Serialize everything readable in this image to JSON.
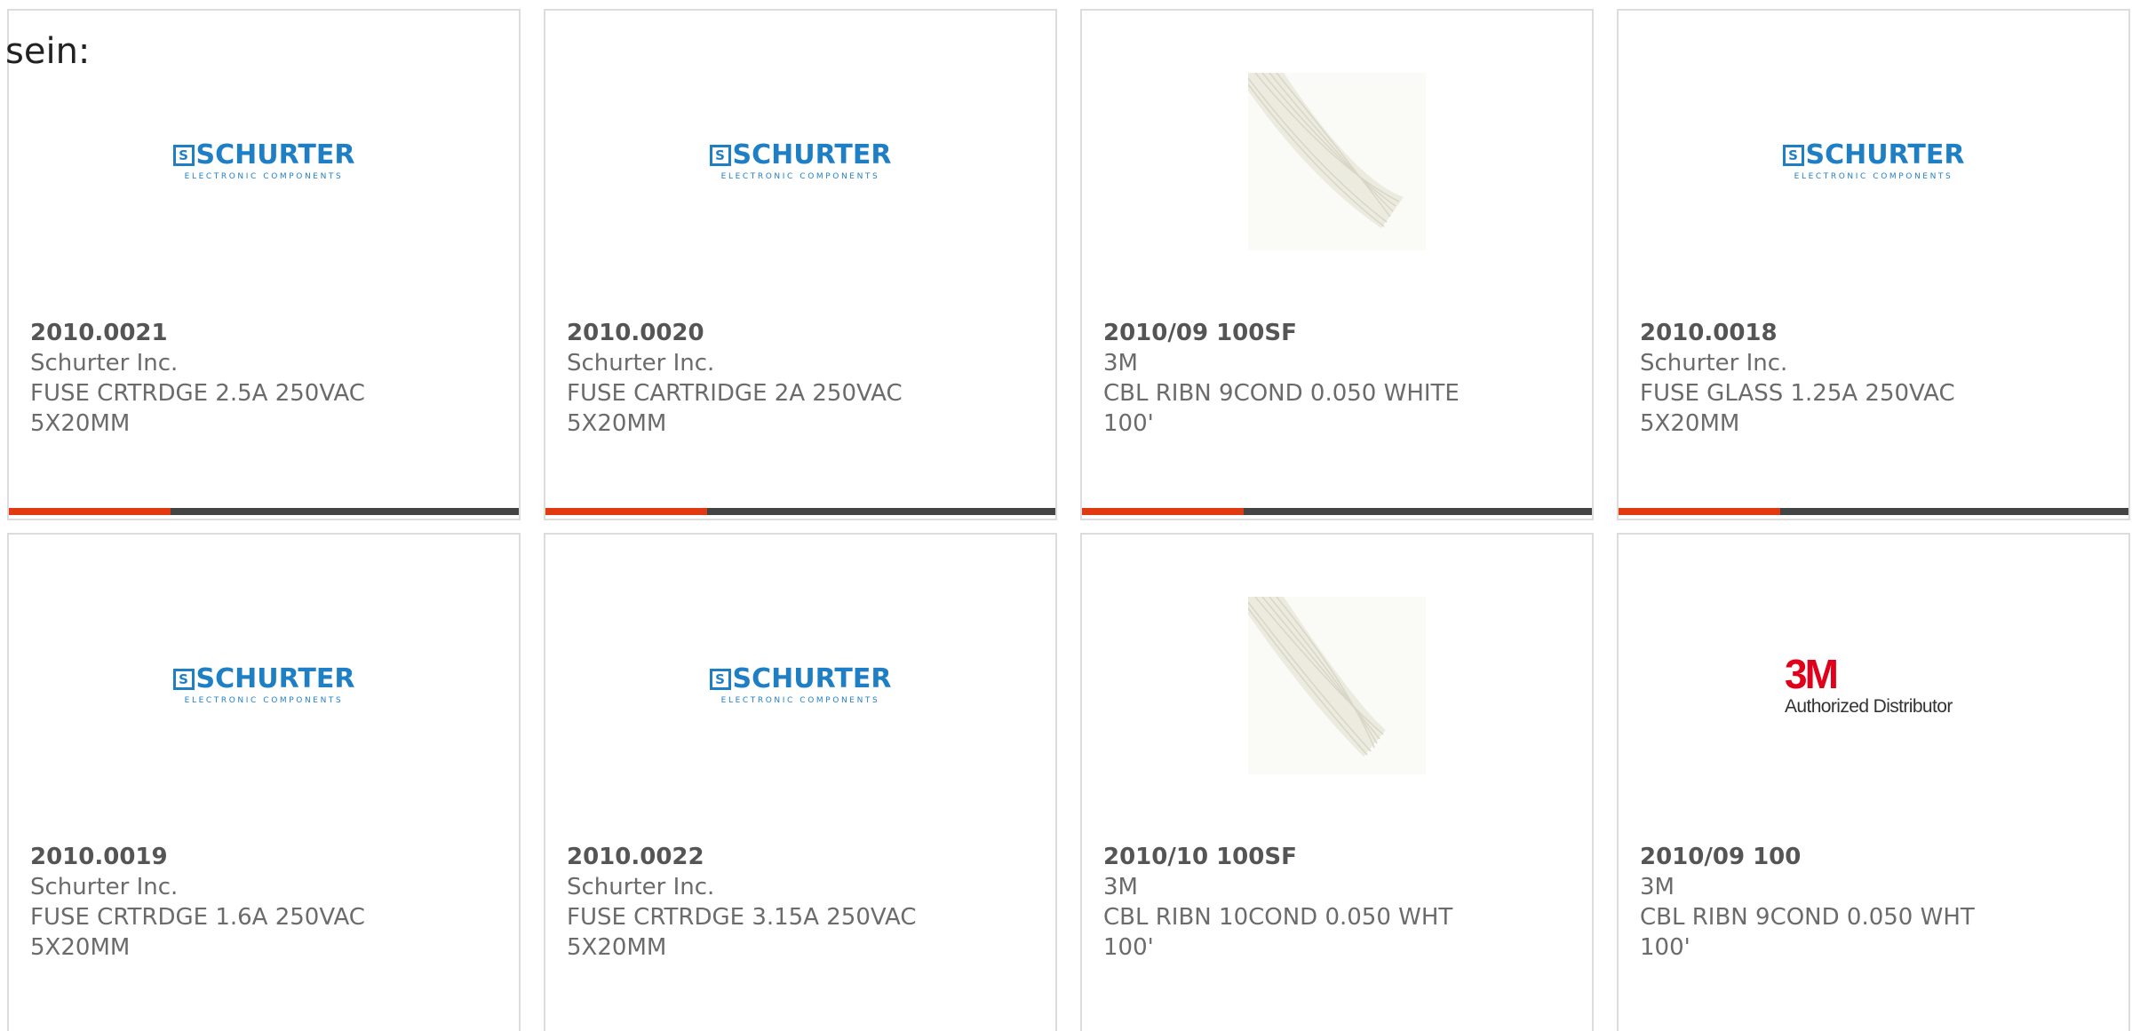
{
  "lead_text": "sein:",
  "colors": {
    "accent_bar": "#e03a12",
    "bar_base": "#444444",
    "schurter_blue": "#1f7fc4",
    "brand_3m_red": "#e0001b"
  },
  "cards": [
    {
      "part_number": "2010.0021",
      "manufacturer": "Schurter Inc.",
      "description": "FUSE CRTRDGE 2.5A 250VAC 5X20MM",
      "image": "schurter-logo",
      "logo": {
        "wordmark": "SCHURTER",
        "badge": "S",
        "tagline": "ELECTRONIC COMPONENTS"
      }
    },
    {
      "part_number": "2010.0020",
      "manufacturer": "Schurter Inc.",
      "description": "FUSE CARTRIDGE 2A 250VAC 5X20MM",
      "image": "schurter-logo",
      "logo": {
        "wordmark": "SCHURTER",
        "badge": "S",
        "tagline": "ELECTRONIC COMPONENTS"
      }
    },
    {
      "part_number": "2010/09 100SF",
      "manufacturer": "3M",
      "description": "CBL RIBN 9COND 0.050 WHITE 100'",
      "image": "ribbon-cable-photo"
    },
    {
      "part_number": "2010.0018",
      "manufacturer": "Schurter Inc.",
      "description": "FUSE GLASS 1.25A 250VAC 5X20MM",
      "image": "schurter-logo",
      "logo": {
        "wordmark": "SCHURTER",
        "badge": "S",
        "tagline": "ELECTRONIC COMPONENTS"
      }
    },
    {
      "part_number": "2010.0019",
      "manufacturer": "Schurter Inc.",
      "description": "FUSE CRTRDGE 1.6A 250VAC 5X20MM",
      "image": "schurter-logo",
      "logo": {
        "wordmark": "SCHURTER",
        "badge": "S",
        "tagline": "ELECTRONIC COMPONENTS"
      }
    },
    {
      "part_number": "2010.0022",
      "manufacturer": "Schurter Inc.",
      "description": "FUSE CRTRDGE 3.15A 250VAC 5X20MM",
      "image": "schurter-logo",
      "logo": {
        "wordmark": "SCHURTER",
        "badge": "S",
        "tagline": "ELECTRONIC COMPONENTS"
      }
    },
    {
      "part_number": "2010/10 100SF",
      "manufacturer": "3M",
      "description": "CBL RIBN 10COND 0.050 WHT 100'",
      "image": "ribbon-cable-photo"
    },
    {
      "part_number": "2010/09 100",
      "manufacturer": "3M",
      "description": "CBL RIBN 9COND 0.050 WHT 100'",
      "image": "3m-logo",
      "logo": {
        "mark": "3M",
        "tagline": "Authorized Distributor"
      }
    }
  ]
}
